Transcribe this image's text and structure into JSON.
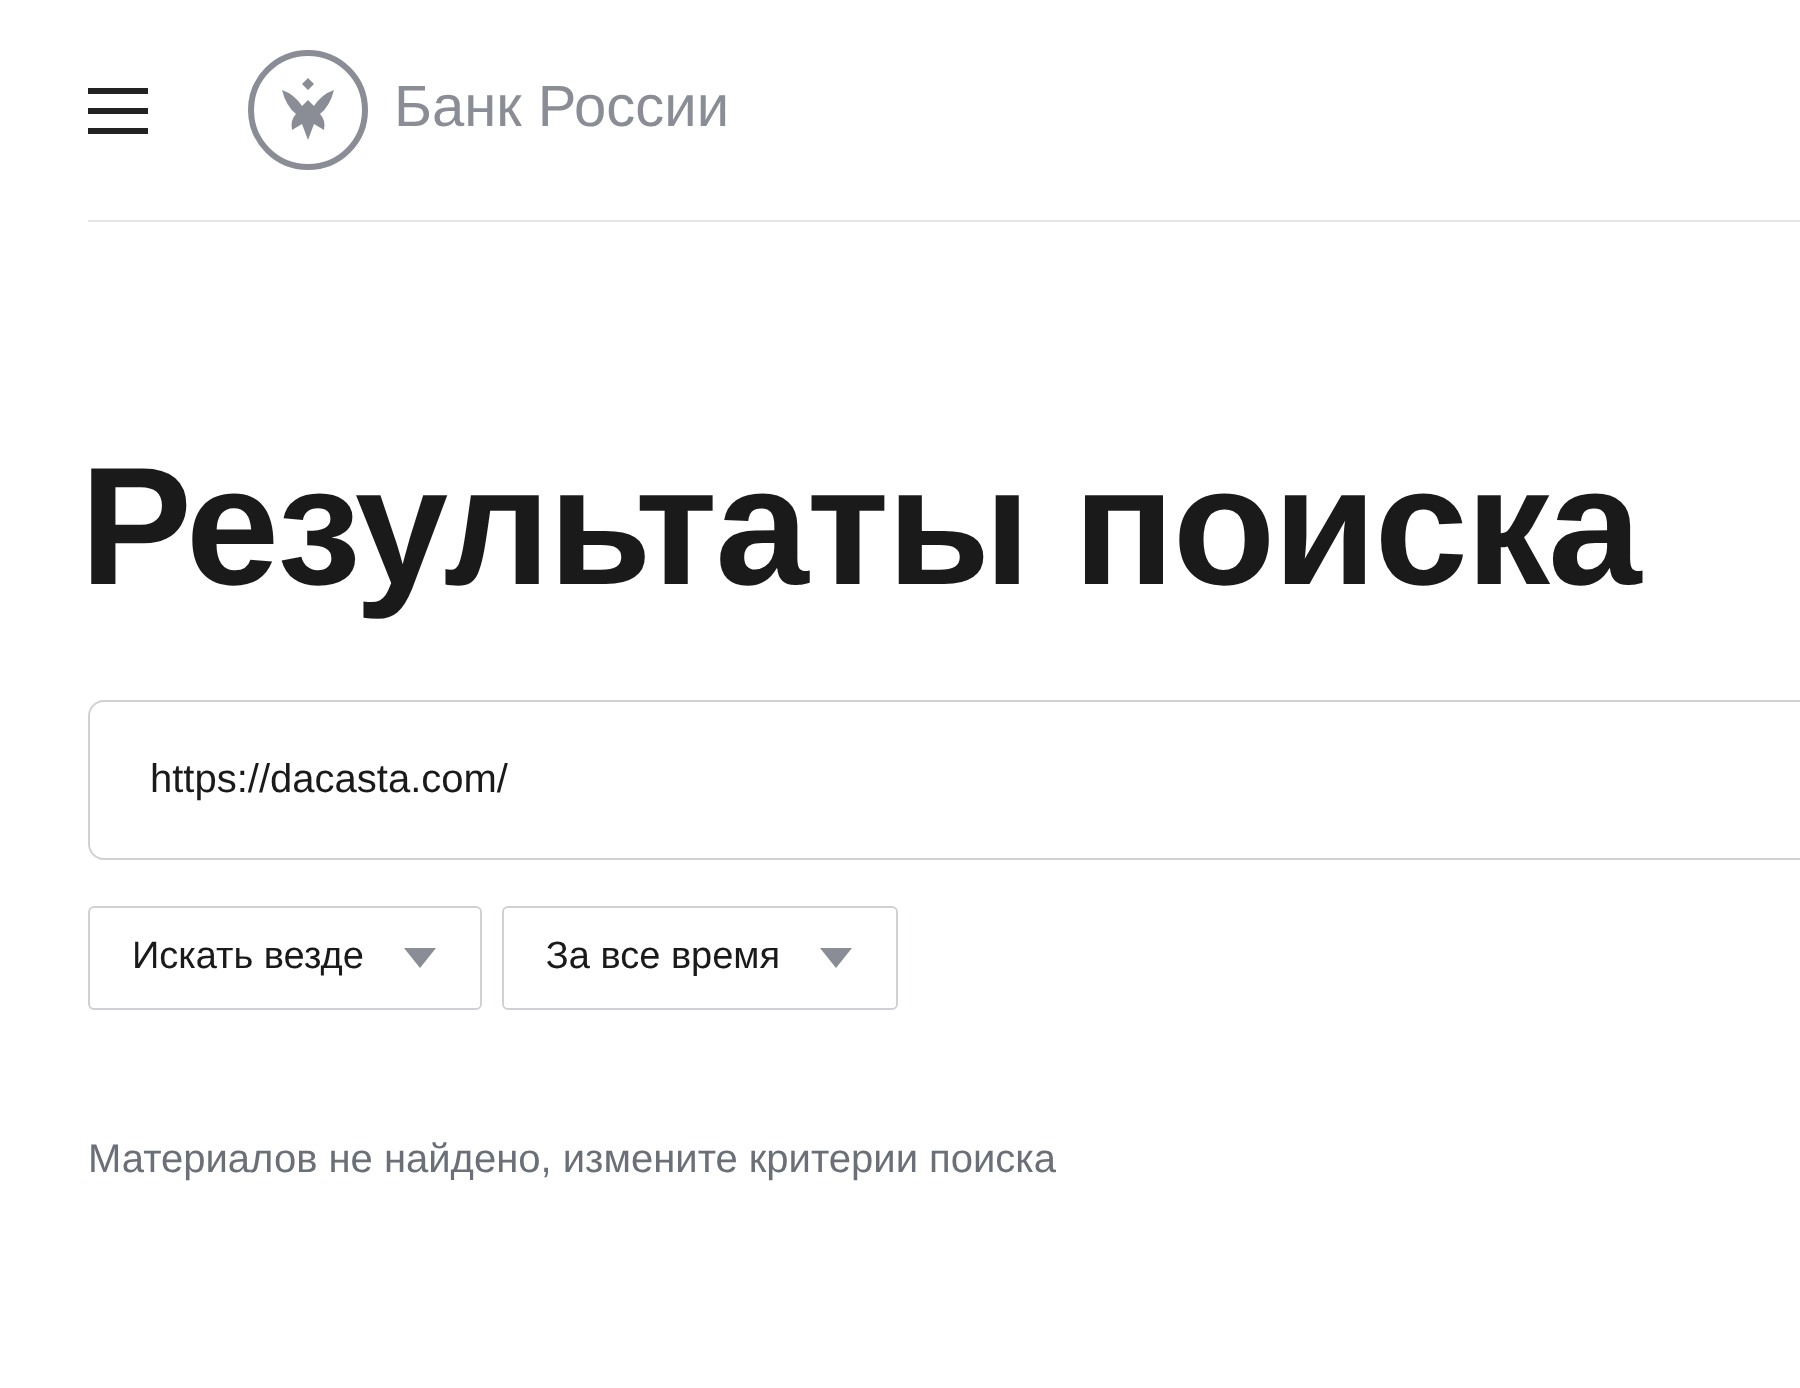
{
  "header": {
    "logo_text": "Банк России"
  },
  "title": "Результаты поиска",
  "search": {
    "value": "https://dacasta.com/"
  },
  "filters": [
    {
      "label": "Искать везде"
    },
    {
      "label": "За все время"
    }
  ],
  "message": "Материалов не найдено, измените критерии поиска"
}
